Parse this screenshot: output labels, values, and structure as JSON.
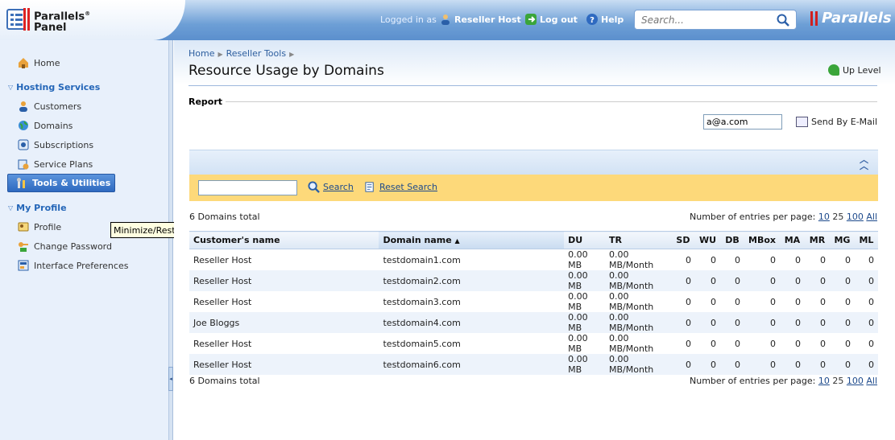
{
  "header": {
    "logo_line1": "Parallels",
    "logo_reg": "®",
    "logo_line2": "Panel",
    "logged_in_as": "Logged in as",
    "user": "Reseller Host",
    "logout": "Log out",
    "help": "Help",
    "search_placeholder": "Search...",
    "brand": "Parallels"
  },
  "sidebar": {
    "home": "Home",
    "hosting_services": "Hosting Services",
    "customers": "Customers",
    "domains": "Domains",
    "subscriptions": "Subscriptions",
    "service_plans": "Service Plans",
    "tools_utilities": "Tools & Utilities",
    "my_profile": "My Profile",
    "profile": "Profile",
    "change_password": "Change Password",
    "interface_preferences": "Interface Preferences",
    "tooltip": "Minimize/Restore"
  },
  "main": {
    "breadcrumb": [
      "Home",
      "Reseller Tools"
    ],
    "title": "Resource Usage by Domains",
    "up_level": "Up Level",
    "report_label": "Report",
    "email_value": "a@a.com",
    "send_email": "Send By E-Mail",
    "search_button": "Search",
    "reset_search": "Reset Search",
    "total_top": "6 Domains total",
    "total_bottom": "6 Domains total",
    "per_page_label": "Number of entries per page:",
    "per_page_options": [
      "10",
      "25",
      "100",
      "All"
    ],
    "columns": [
      "Customer's name",
      "Domain name",
      "DU",
      "TR",
      "SD",
      "WU",
      "DB",
      "MBox",
      "MA",
      "MR",
      "MG",
      "ML"
    ],
    "sort_indicator": "▲",
    "rows": [
      [
        "Reseller Host",
        "testdomain1.com",
        "0.00 MB",
        "0.00 MB/Month",
        "0",
        "0",
        "0",
        "0",
        "0",
        "0",
        "0",
        "0"
      ],
      [
        "Reseller Host",
        "testdomain2.com",
        "0.00 MB",
        "0.00 MB/Month",
        "0",
        "0",
        "0",
        "0",
        "0",
        "0",
        "0",
        "0"
      ],
      [
        "Reseller Host",
        "testdomain3.com",
        "0.00 MB",
        "0.00 MB/Month",
        "0",
        "0",
        "0",
        "0",
        "0",
        "0",
        "0",
        "0"
      ],
      [
        "Joe Bloggs",
        "testdomain4.com",
        "0.00 MB",
        "0.00 MB/Month",
        "0",
        "0",
        "0",
        "0",
        "0",
        "0",
        "0",
        "0"
      ],
      [
        "Reseller Host",
        "testdomain5.com",
        "0.00 MB",
        "0.00 MB/Month",
        "0",
        "0",
        "0",
        "0",
        "0",
        "0",
        "0",
        "0"
      ],
      [
        "Reseller Host",
        "testdomain6.com",
        "0.00 MB",
        "0.00 MB/Month",
        "0",
        "0",
        "0",
        "0",
        "0",
        "0",
        "0",
        "0"
      ]
    ]
  }
}
